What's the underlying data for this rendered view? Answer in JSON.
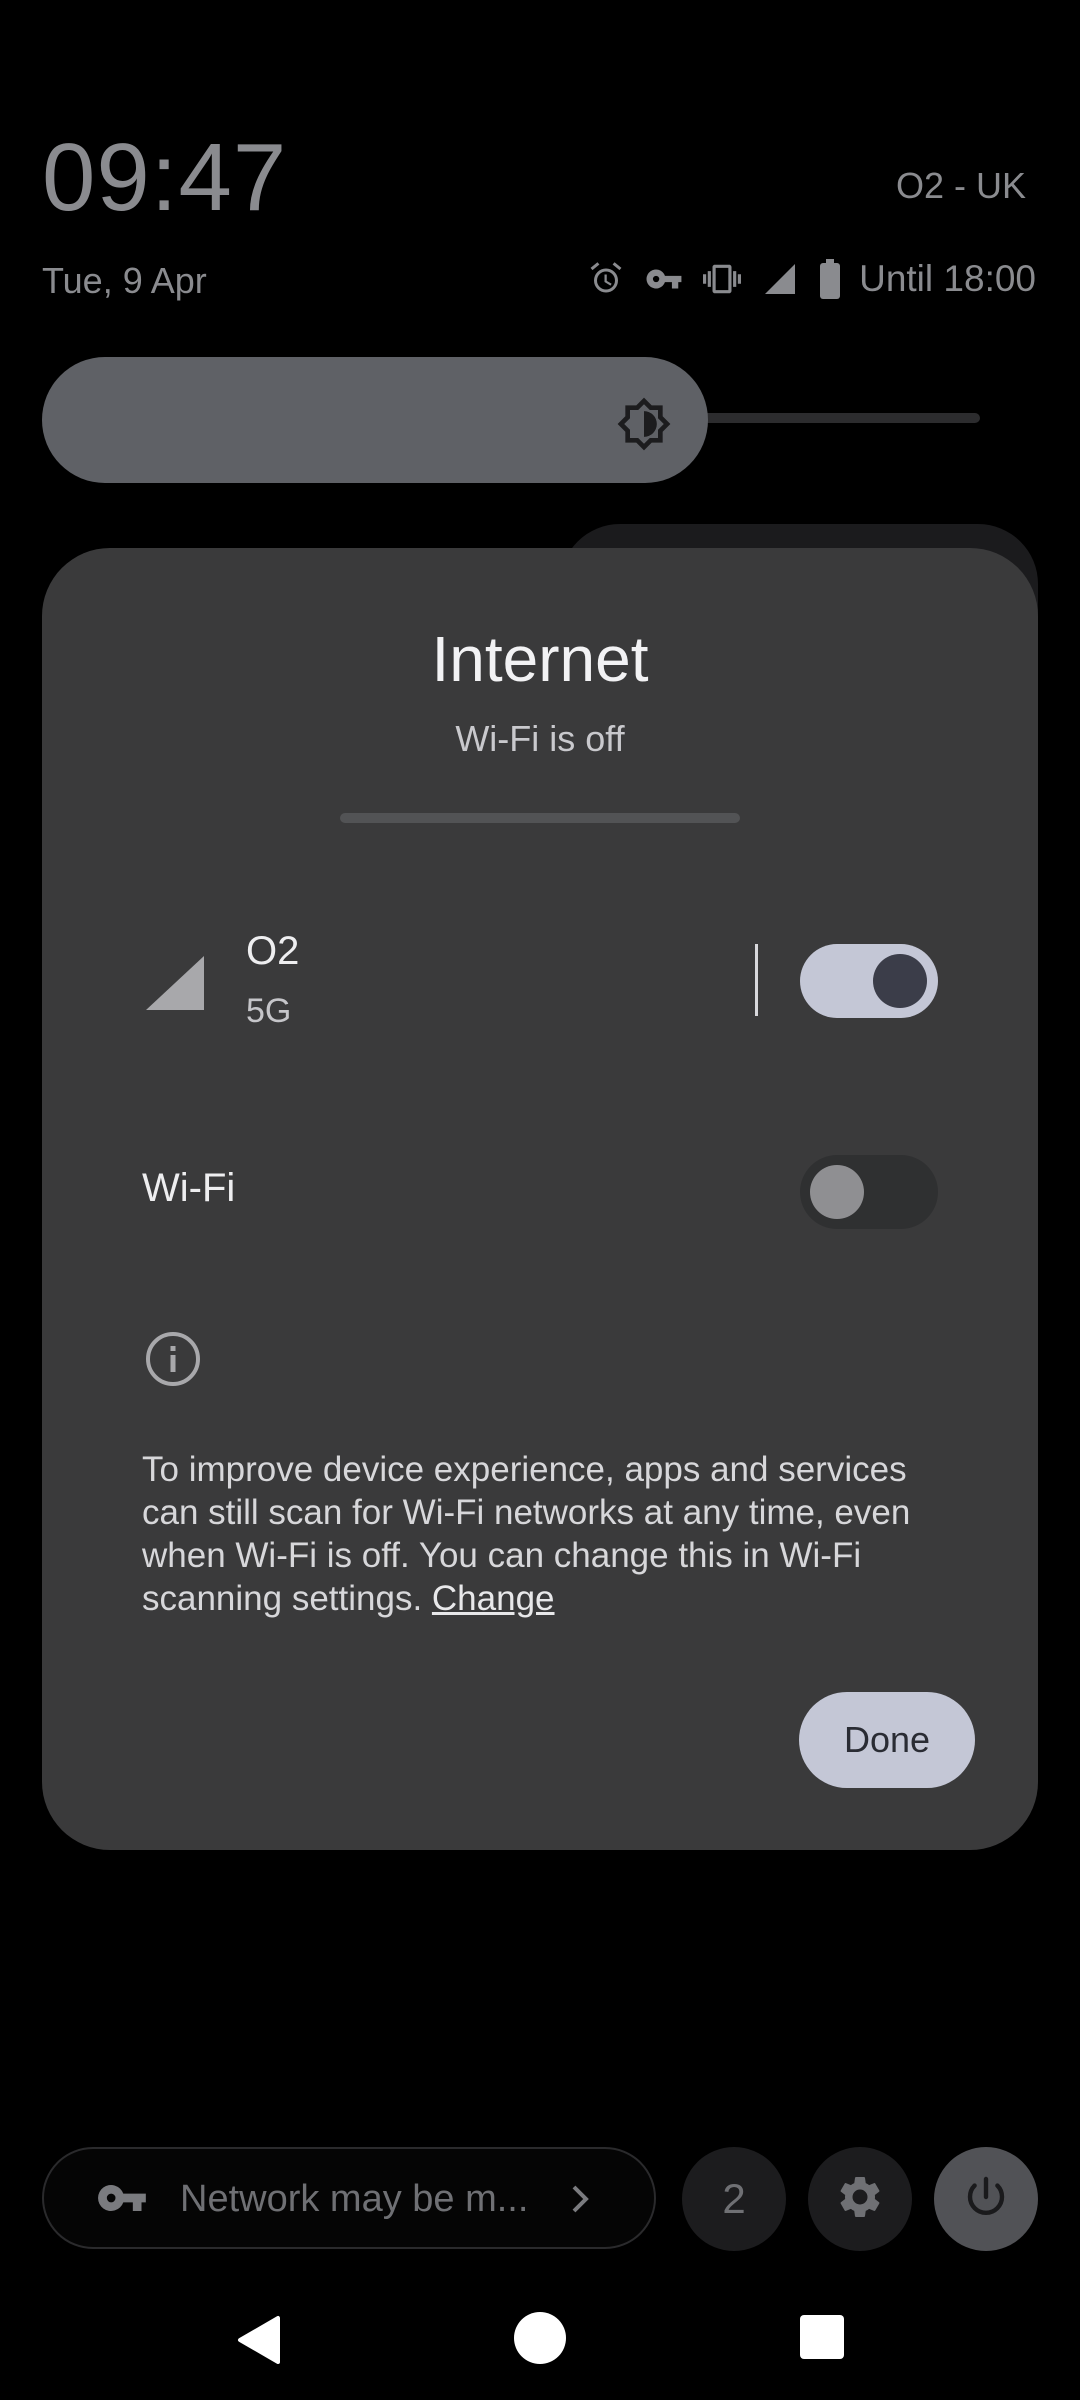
{
  "status": {
    "time": "09:47",
    "carrier": "O2 - UK",
    "date": "Tue, 9 Apr",
    "battery_text": "Until 18:00",
    "icons": [
      "alarm-icon",
      "vpn-key-icon",
      "vibrate-icon",
      "cell-signal-icon",
      "battery-icon"
    ]
  },
  "brightness": {
    "level": 0.64,
    "icon": "brightness-icon"
  },
  "dialog": {
    "title": "Internet",
    "subtitle": "Wi-Fi is off",
    "mobile": {
      "name": "O2",
      "type": "5G",
      "enabled": true
    },
    "wifi": {
      "label": "Wi-Fi",
      "enabled": false
    },
    "info_text": "To improve device experience, apps and services can still scan for Wi-Fi networks at any time, even when Wi-Fi is off. You can change this in Wi-Fi scanning settings.",
    "change_link": "Change",
    "done_label": "Done"
  },
  "bottom": {
    "security_text": "Network may be m...",
    "users_count": "2",
    "icons": [
      "vpn-key-icon",
      "chevron-right-icon",
      "gear-icon",
      "power-icon"
    ]
  },
  "colors": {
    "dialog_bg": "#3a3a3b",
    "accent": "#c4c7d6",
    "background": "#000000"
  }
}
